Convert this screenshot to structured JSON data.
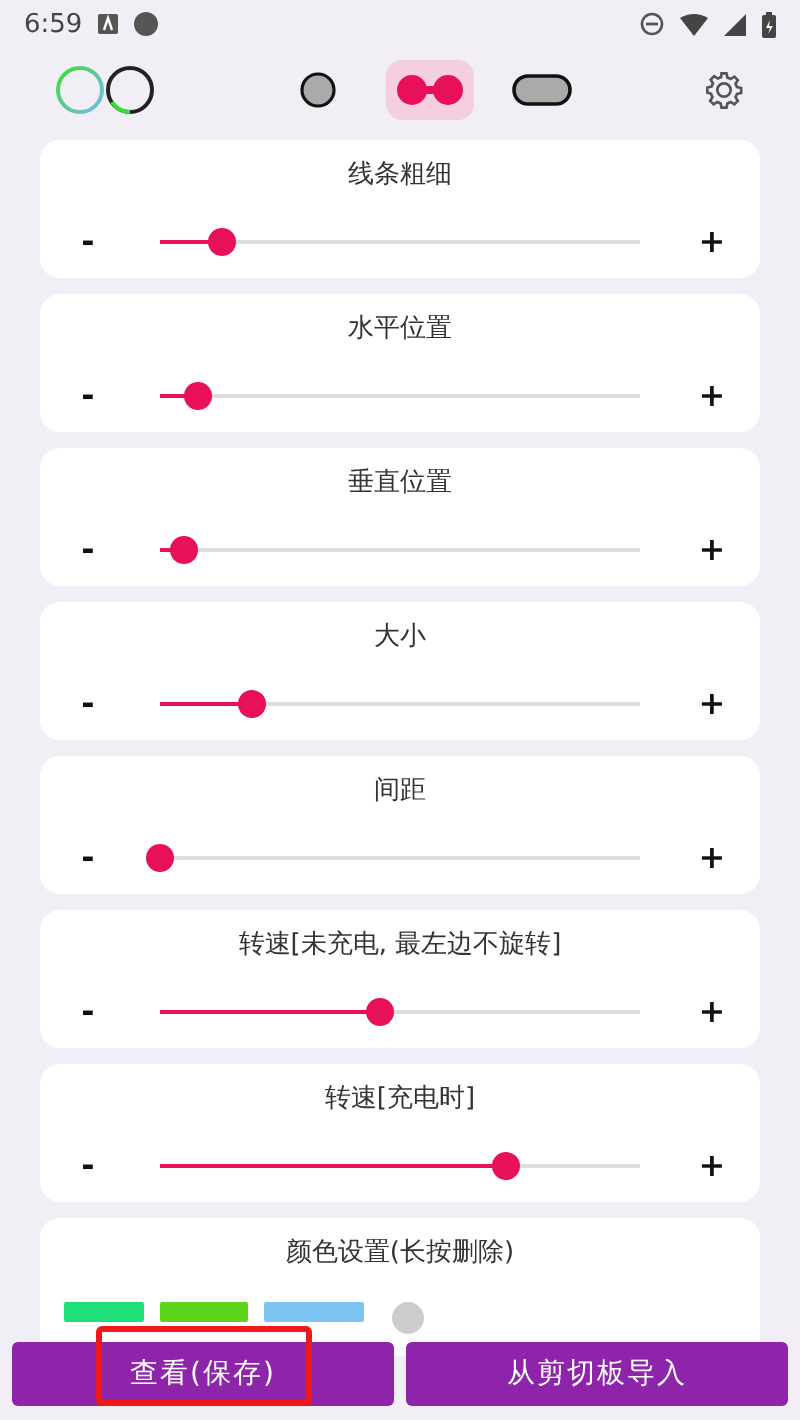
{
  "status_bar": {
    "time": "6:59"
  },
  "modes": [
    {
      "kind": "dot",
      "selected": false
    },
    {
      "kind": "pair",
      "selected": true
    },
    {
      "kind": "pill",
      "selected": false
    }
  ],
  "sliders": [
    {
      "label": "线条粗细",
      "minus": "-",
      "plus": "+",
      "level": 0.13
    },
    {
      "label": "水平位置",
      "minus": "-",
      "plus": "+",
      "level": 0.08
    },
    {
      "label": "垂直位置",
      "minus": "-",
      "plus": "+",
      "level": 0.05
    },
    {
      "label": "大小",
      "minus": "-",
      "plus": "+",
      "level": 0.19
    },
    {
      "label": "间距",
      "minus": "-",
      "plus": "+",
      "level": 0.0
    },
    {
      "label": "转速[未充电, 最左边不旋转]",
      "minus": "-",
      "plus": "+",
      "level": 0.46
    },
    {
      "label": "转速[充电时]",
      "minus": "-",
      "plus": "+",
      "level": 0.72
    }
  ],
  "colors": {
    "title": "颜色设置(长按删除)",
    "swatches": [
      {
        "color": "#1de07a"
      },
      {
        "color": "#5cd61a"
      },
      {
        "color": "#7ec4f2"
      }
    ]
  },
  "buttons": [
    {
      "label": "查看(保存)",
      "highlighted": true
    },
    {
      "label": "从剪切板导入",
      "highlighted": false
    }
  ]
}
